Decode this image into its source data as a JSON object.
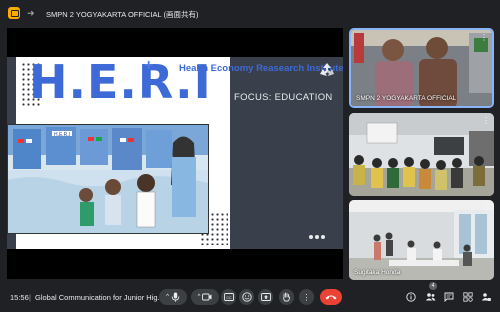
{
  "header": {
    "title": "SMPN 2 YOGYAKARTA OFFICIAL (画面共有)"
  },
  "slide": {
    "logo_text": "H.E.R.I",
    "plus": "+",
    "institute_title": "Health Economy Reasearch Institute",
    "focus": "FOCUS: EDUCATION",
    "art_caption": "H.E.R.I"
  },
  "participants": [
    {
      "name": "SMPN 2 YOGYAKARTA OFFICIAL"
    },
    {
      "name": ""
    },
    {
      "name": "Sugitaka Honda"
    }
  ],
  "footer": {
    "time": "15:56",
    "separator": "|",
    "meeting_title": "Global Communication for Junior Hig...",
    "people_count": "4"
  },
  "controls": {
    "mic": "mic-icon",
    "camera": "camera-icon",
    "captions": "captions-icon",
    "emoji": "emoji-icon",
    "present": "present-icon",
    "raise_hand": "hand-icon",
    "more": "more-vert-icon",
    "end_call": "end-call-icon"
  },
  "colors": {
    "accent": "#8ab4f8",
    "end_call": "#ea4335",
    "presenting": "#f9ab00",
    "logo_blue": "#3d6ad6"
  }
}
